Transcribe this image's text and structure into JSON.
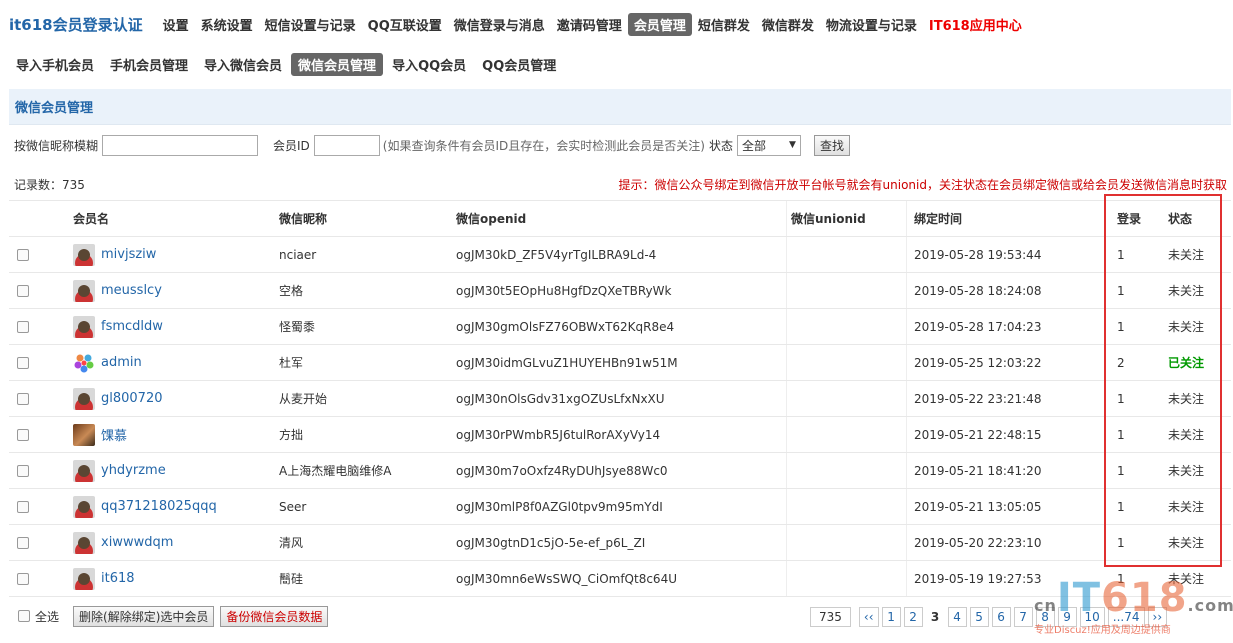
{
  "topnav": {
    "brand": "it618会员登录认证",
    "items": [
      "设置",
      "系统设置",
      "短信设置与记录",
      "QQ互联设置",
      "微信登录与消息",
      "邀请码管理",
      "会员管理",
      "短信群发",
      "微信群发",
      "物流设置与记录",
      "IT618应用中心"
    ]
  },
  "subnav": {
    "items": [
      "导入手机会员",
      "手机会员管理",
      "导入微信会员",
      "微信会员管理",
      "导入QQ会员",
      "QQ会员管理"
    ]
  },
  "section": {
    "title": "微信会员管理"
  },
  "search": {
    "nick_label": "按微信昵称模糊",
    "nick_value": "",
    "id_label": "会员ID",
    "id_value": "",
    "hint": "(如果查询条件有会员ID且存在，会实时检测此会员是否关注)",
    "status_label": "状态",
    "status_value": "全部",
    "search_button": "查找"
  },
  "count_text": "记录数：735",
  "tip": "提示：微信公众号绑定到微信开放平台帐号就会有unionid，关注状态在会员绑定微信或给会员发送微信消息时获取",
  "table": {
    "headers": {
      "name": "会员名",
      "nick": "微信昵称",
      "openid": "微信openid",
      "unionid": "微信unionid",
      "time": "绑定时间",
      "login": "登录",
      "status": "状态"
    },
    "rows": [
      {
        "name": "mivjsziw",
        "nick": "nciaer",
        "openid": "ogJM30kD_ZF5V4yrTgILBRA9Ld-4",
        "unionid": "",
        "time": "2019-05-28 19:53:44",
        "login": "1",
        "status": "未关注",
        "avatar": "default"
      },
      {
        "name": "meusslcy",
        "nick": "空格",
        "openid": "ogJM30t5EOpHu8HgfDzQXeTBRyWk",
        "unionid": "",
        "time": "2019-05-28 18:24:08",
        "login": "1",
        "status": "未关注",
        "avatar": "default"
      },
      {
        "name": "fsmcdldw",
        "nick": "怪蜀黍",
        "openid": "ogJM30gmOlsFZ76OBWxT62KqR8e4",
        "unionid": "",
        "time": "2019-05-28 17:04:23",
        "login": "1",
        "status": "未关注",
        "avatar": "default"
      },
      {
        "name": "admin",
        "nick": "杜军",
        "openid": "ogJM30idmGLvuZ1HUYEHBn91w51M",
        "unionid": "",
        "time": "2019-05-25 12:03:22",
        "login": "2",
        "status": "已关注",
        "avatar": "flower"
      },
      {
        "name": "gl800720",
        "nick": "从麦开始",
        "openid": "ogJM30nOlsGdv31xgOZUsLfxNxXU",
        "unionid": "",
        "time": "2019-05-22 23:21:48",
        "login": "1",
        "status": "未关注",
        "avatar": "default"
      },
      {
        "name": "馃慕",
        "nick": "方拙",
        "openid": "ogJM30rPWmbR5J6tulRorAXyVy14",
        "unionid": "",
        "time": "2019-05-21 22:48:15",
        "login": "1",
        "status": "未关注",
        "avatar": "photo"
      },
      {
        "name": "yhdyrzme",
        "nick": "A上海杰耀电脑维修A",
        "openid": "ogJM30m7oOxfz4RyDUhJsye88Wc0",
        "unionid": "",
        "time": "2019-05-21 18:41:20",
        "login": "1",
        "status": "未关注",
        "avatar": "default"
      },
      {
        "name": "qq371218025qqq",
        "nick": "Seer",
        "openid": "ogJM30mlP8f0AZGl0tpv9m95mYdI",
        "unionid": "",
        "time": "2019-05-21 13:05:05",
        "login": "1",
        "status": "未关注",
        "avatar": "default"
      },
      {
        "name": "xiwwwdqm",
        "nick": "清风",
        "openid": "ogJM30gtnD1c5jO-5e-ef_p6L_ZI",
        "unionid": "",
        "time": "2019-05-20 22:23:10",
        "login": "1",
        "status": "未关注",
        "avatar": "default"
      },
      {
        "name": "it618",
        "nick": "鬝硅",
        "openid": "ogJM30mn6eWsSWQ_CiOmfQt8c64U",
        "unionid": "",
        "time": "2019-05-19 19:27:53",
        "login": "1",
        "status": "未关注",
        "avatar": "default"
      }
    ]
  },
  "footer": {
    "select_all": "全选",
    "delete_button": "删除(解除绑定)选中会员",
    "backup_button": "备份微信会员数据"
  },
  "pager": {
    "total": "735",
    "prev": "‹‹",
    "pages": [
      "1",
      "2",
      "3",
      "4",
      "5",
      "6",
      "7",
      "8",
      "9",
      "10",
      "...74",
      "››"
    ],
    "current": "3"
  },
  "watermark": {
    "logo_cn": "cn",
    "logo_it": "IT",
    "logo_618": "618",
    "logo_com": ".com",
    "slogan": "专业Discuz!应用及周边提供商"
  },
  "colors": {
    "accent": "#2366a8",
    "highlight_box": "#e03030",
    "followed": "#009900"
  }
}
